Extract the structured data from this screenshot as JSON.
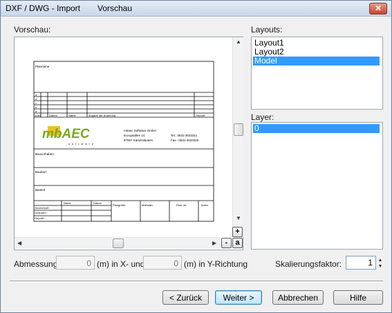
{
  "window": {
    "title": "DXF / DWG - Import",
    "subtitle": "Vorschau",
    "close_glyph": "✕"
  },
  "preview": {
    "label": "Vorschau:",
    "zoom_in": "+",
    "zoom_out": "-",
    "zoom_auto": "a",
    "drawing": {
      "plan_label": "Planname",
      "rev_rows": [
        "a",
        "d",
        "c",
        "b",
        "a"
      ],
      "rev_header": [
        "Index",
        "Datum",
        "Name",
        "Angabe der Änderung",
        "Geprüft"
      ],
      "logo": "mbAEC",
      "logo_sub": "software",
      "company": [
        "mbaec Software GmbH",
        "Europaallee 14",
        "67657 Kaiserslautern"
      ],
      "tel": "Tel.:   0631-3033311",
      "fax": "Fax.:   0631-3033320",
      "fields": [
        "Bauvorhaben:",
        "Bauherr:",
        "Bauteil:"
      ],
      "bottom_header": [
        "Name",
        "Datum"
      ],
      "bottom_rows": [
        "Gezeichnet :",
        "Geändert :",
        "Geprüft :"
      ],
      "bottom_cells": [
        "Plangröße",
        "Maßstab:",
        "Plan.-Nr.",
        "Index"
      ]
    }
  },
  "layouts": {
    "label": "Layouts:",
    "items": [
      "Layout1",
      "Layout2",
      "Model"
    ],
    "selected": "Model"
  },
  "layers": {
    "label": "Layer:",
    "items": [
      "0"
    ],
    "selected": "0"
  },
  "dimension": {
    "label": "Abmessung:",
    "x_value": "0",
    "x_unit_text": "(m) in X- und",
    "y_value": "0",
    "y_unit_text": "(m)  in Y-Richtung"
  },
  "scale": {
    "label": "Skalierungsfaktor:",
    "value": "1"
  },
  "buttons": {
    "back": "< Zurück",
    "next": "Weiter >",
    "cancel": "Abbrechen",
    "help": "Hilfe"
  },
  "colors": {
    "selection": "#3399ff",
    "logo_green": "#7da822",
    "logo_yellow": "#f0c020"
  }
}
